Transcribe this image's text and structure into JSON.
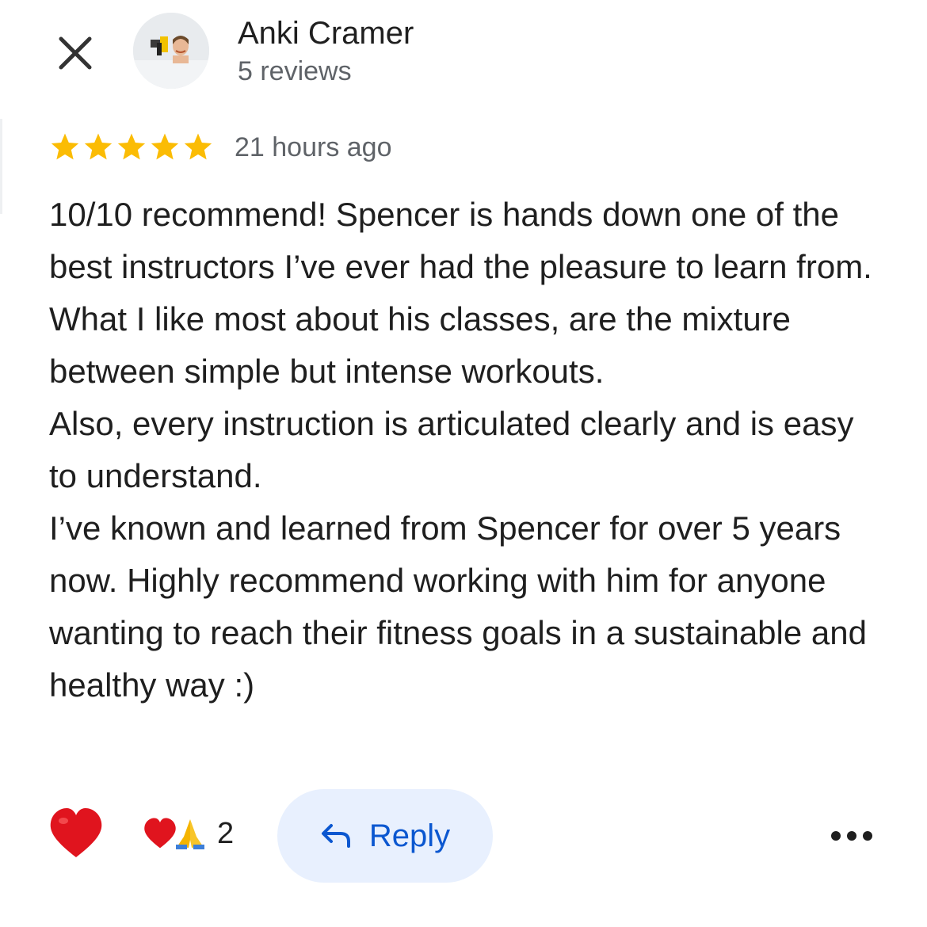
{
  "header": {
    "close_icon": "close-icon",
    "author_name": "Anki Cramer",
    "review_count": "5 reviews"
  },
  "review": {
    "rating": 5,
    "rating_max": 5,
    "star_color": "#fbbc04",
    "timestamp": "21 hours ago",
    "paragraphs": [
      "10/10 recommend! Spencer is hands down one of the best instructors I’ve ever had the pleasure to learn from. What I like most about his classes, are the mixture between simple but intense workouts.",
      "Also, every instruction is articulated clearly and is easy to understand.",
      "I’ve known and learned from Spencer for over 5 years now. Highly recommend working with him for anyone wanting to reach their fitness goals in a sustainable and healthy way :)"
    ]
  },
  "actions": {
    "like_icon": "heart-icon",
    "reaction_icons": [
      "heart-icon",
      "folded-hands-icon"
    ],
    "reaction_count": "2",
    "reply_label": "Reply",
    "reply_icon": "reply-arrow-icon",
    "more_icon": "more-options-icon",
    "accent_color": "#0b57d0",
    "reply_bg_color": "#e8f0fe",
    "heart_color": "#e0141e"
  }
}
